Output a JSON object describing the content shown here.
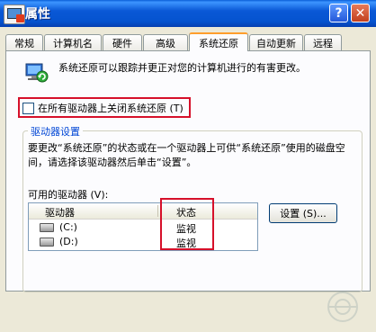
{
  "window": {
    "title": "属性",
    "icon": "system-properties-icon",
    "help_label": "?",
    "close_label": "✕"
  },
  "tabs": [
    {
      "label": "常规",
      "active": false
    },
    {
      "label": "计算机名",
      "active": false
    },
    {
      "label": "硬件",
      "active": false
    },
    {
      "label": "高级",
      "active": false
    },
    {
      "label": "系统还原",
      "active": true
    },
    {
      "label": "自动更新",
      "active": false
    },
    {
      "label": "远程",
      "active": false
    }
  ],
  "panel": {
    "description": "系统还原可以跟踪并更正对您的计算机进行的有害更改。",
    "disable_checkbox": {
      "label": "在所有驱动器上关闭系统还原 (T)",
      "checked": false
    },
    "drive_settings": {
      "title": "驱动器设置",
      "text": "要更改“系统还原”的状态或在一个驱动器上可供“系统还原”使用的磁盘空间，请选择该驱动器然后单击“设置”。",
      "available_label": "可用的驱动器 (V):",
      "columns": {
        "drive": "驱动器",
        "status": "状态"
      },
      "drives": [
        {
          "name": "(C:)",
          "status": "监视"
        },
        {
          "name": "(D:)",
          "status": "监视"
        }
      ],
      "settings_button": "设置 (S)..."
    }
  },
  "colors": {
    "highlight_box": "#d6102a",
    "titlebar": "#0553cf",
    "active_tab_accent": "#ff9e2c",
    "group_title": "#0046d5"
  }
}
